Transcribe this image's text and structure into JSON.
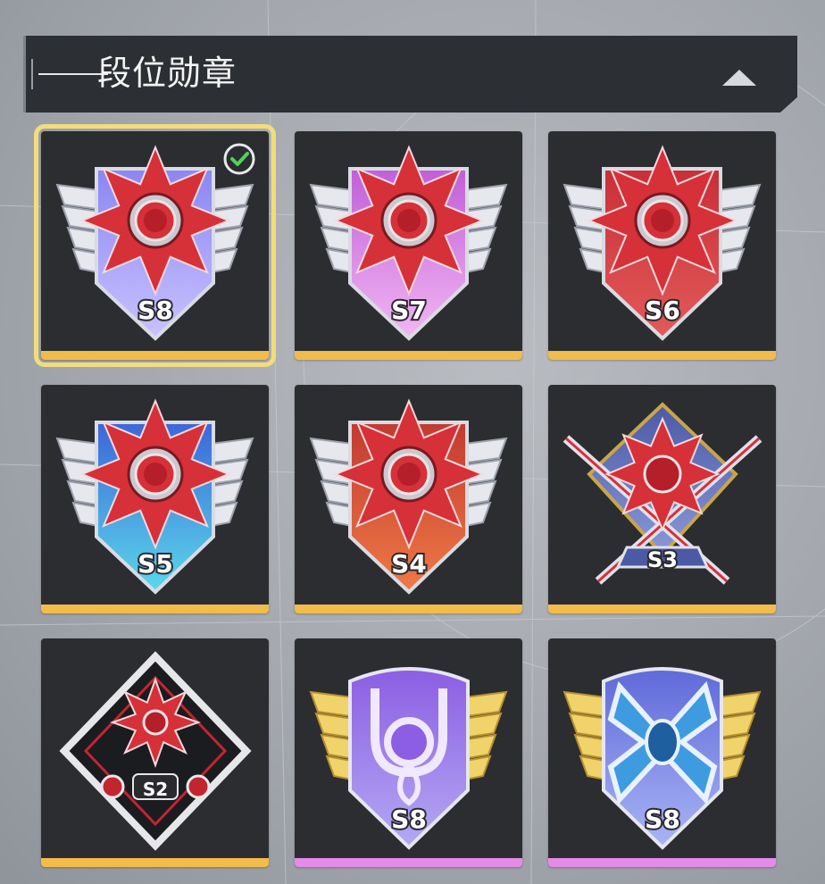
{
  "header": {
    "title": "段位勋章"
  },
  "colors": {
    "gold_bar": "#f2bb4a",
    "pink_bar": "#e48be9",
    "selected_outline": "#f3dc79",
    "check_green": "#4fd25a"
  },
  "medals": [
    {
      "label": "S8",
      "shield": "#8b86f2",
      "shield_low": "#c9c2ff",
      "star": "#d63038",
      "bar": "gold",
      "selected": true,
      "style": "star-wings"
    },
    {
      "label": "S7",
      "shield": "#c05fd8",
      "shield_low": "#f2b6f3",
      "star": "#d63038",
      "bar": "gold",
      "selected": false,
      "style": "star-wings"
    },
    {
      "label": "S6",
      "shield": "#c82f37",
      "shield_low": "#e25a5a",
      "star": "#d63038",
      "bar": "gold",
      "selected": false,
      "style": "star-wings"
    },
    {
      "label": "S5",
      "shield": "#3d66d8",
      "shield_low": "#5ad8ea",
      "star": "#d63038",
      "bar": "gold",
      "selected": false,
      "style": "star-wings"
    },
    {
      "label": "S4",
      "shield": "#c23a31",
      "shield_low": "#ef7a45",
      "star": "#d63038",
      "bar": "gold",
      "selected": false,
      "style": "star-wings"
    },
    {
      "label": "S3",
      "shield": "#4c5aa6",
      "shield_low": "#8a97d8",
      "star": "#d63038",
      "bar": "gold",
      "selected": false,
      "style": "swords"
    },
    {
      "label": "S2",
      "shield": "#1b1c20",
      "shield_low": "#e7e7ea",
      "star": "#d63038",
      "bar": "gold",
      "selected": false,
      "style": "diamond"
    },
    {
      "label": "S8",
      "shield": "#8c5ee3",
      "shield_low": "#b3a9f3",
      "star": "#8c5ee3",
      "bar": "pink",
      "selected": false,
      "style": "emblem-purple"
    },
    {
      "label": "S8",
      "shield": "#5f6ad9",
      "shield_low": "#a9b4f6",
      "star": "#3f9be0",
      "bar": "pink",
      "selected": false,
      "style": "emblem-blue"
    }
  ]
}
